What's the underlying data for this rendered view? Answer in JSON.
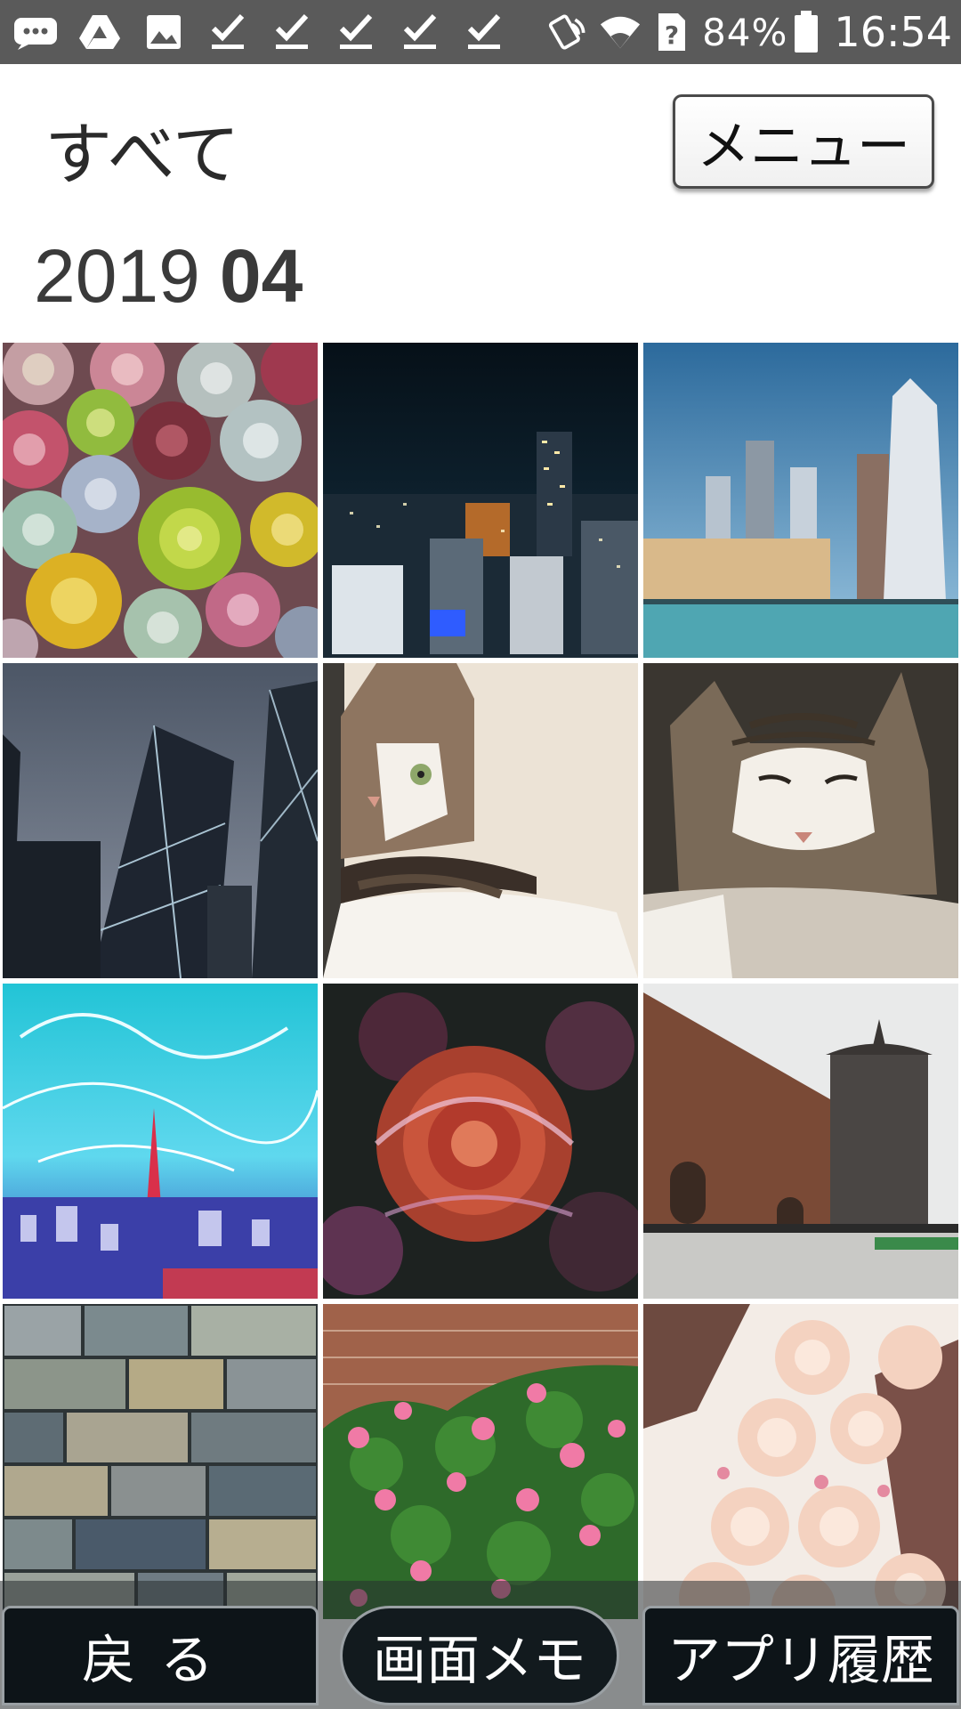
{
  "status_bar": {
    "left_icons": [
      "message-icon",
      "drive-icon",
      "gallery-icon",
      "check-icon",
      "check-icon",
      "check-icon",
      "check-icon",
      "check-icon"
    ],
    "right_icons": [
      "nfc-icon",
      "wifi-icon",
      "sim-unknown-icon",
      "battery-icon"
    ],
    "battery": "84%",
    "time": "16:54"
  },
  "header": {
    "title": "すべて",
    "menu_label": "メニュー"
  },
  "date_group": {
    "year": "2019",
    "month": "04"
  },
  "photos": [
    {
      "subject": "succulents"
    },
    {
      "subject": "night-city"
    },
    {
      "subject": "skyscrapers-waterfront"
    },
    {
      "subject": "glass-towers"
    },
    {
      "subject": "tabby-cat-peeking"
    },
    {
      "subject": "sleeping-cat"
    },
    {
      "subject": "light-art-tower"
    },
    {
      "subject": "red-rose-abstract"
    },
    {
      "subject": "castle-tower"
    },
    {
      "subject": "stone-wall"
    },
    {
      "subject": "pink-roses-brick"
    },
    {
      "subject": "peach-roses-box"
    }
  ],
  "bottom_nav": {
    "back": "戻る",
    "memo": "画面メモ",
    "history": "アプリ履歴"
  }
}
